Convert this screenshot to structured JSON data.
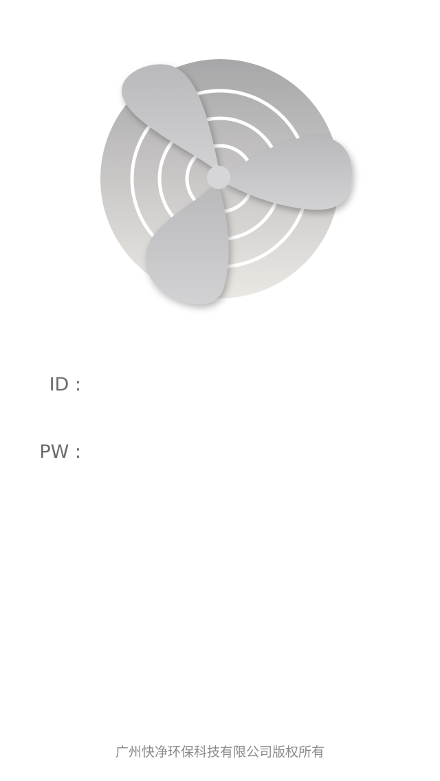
{
  "logo": {
    "icon": "fan-icon",
    "colors": {
      "disc_top": "#a8a7a9",
      "disc_bottom": "#e9e6e2",
      "blade": "#c3c3c5",
      "rings": "#ffffff"
    }
  },
  "login": {
    "id_label": "ID :",
    "id_value": "",
    "pw_label": "PW :",
    "pw_value": ""
  },
  "footer": {
    "copyright": "广州快净环保科技有限公司版权所有"
  }
}
